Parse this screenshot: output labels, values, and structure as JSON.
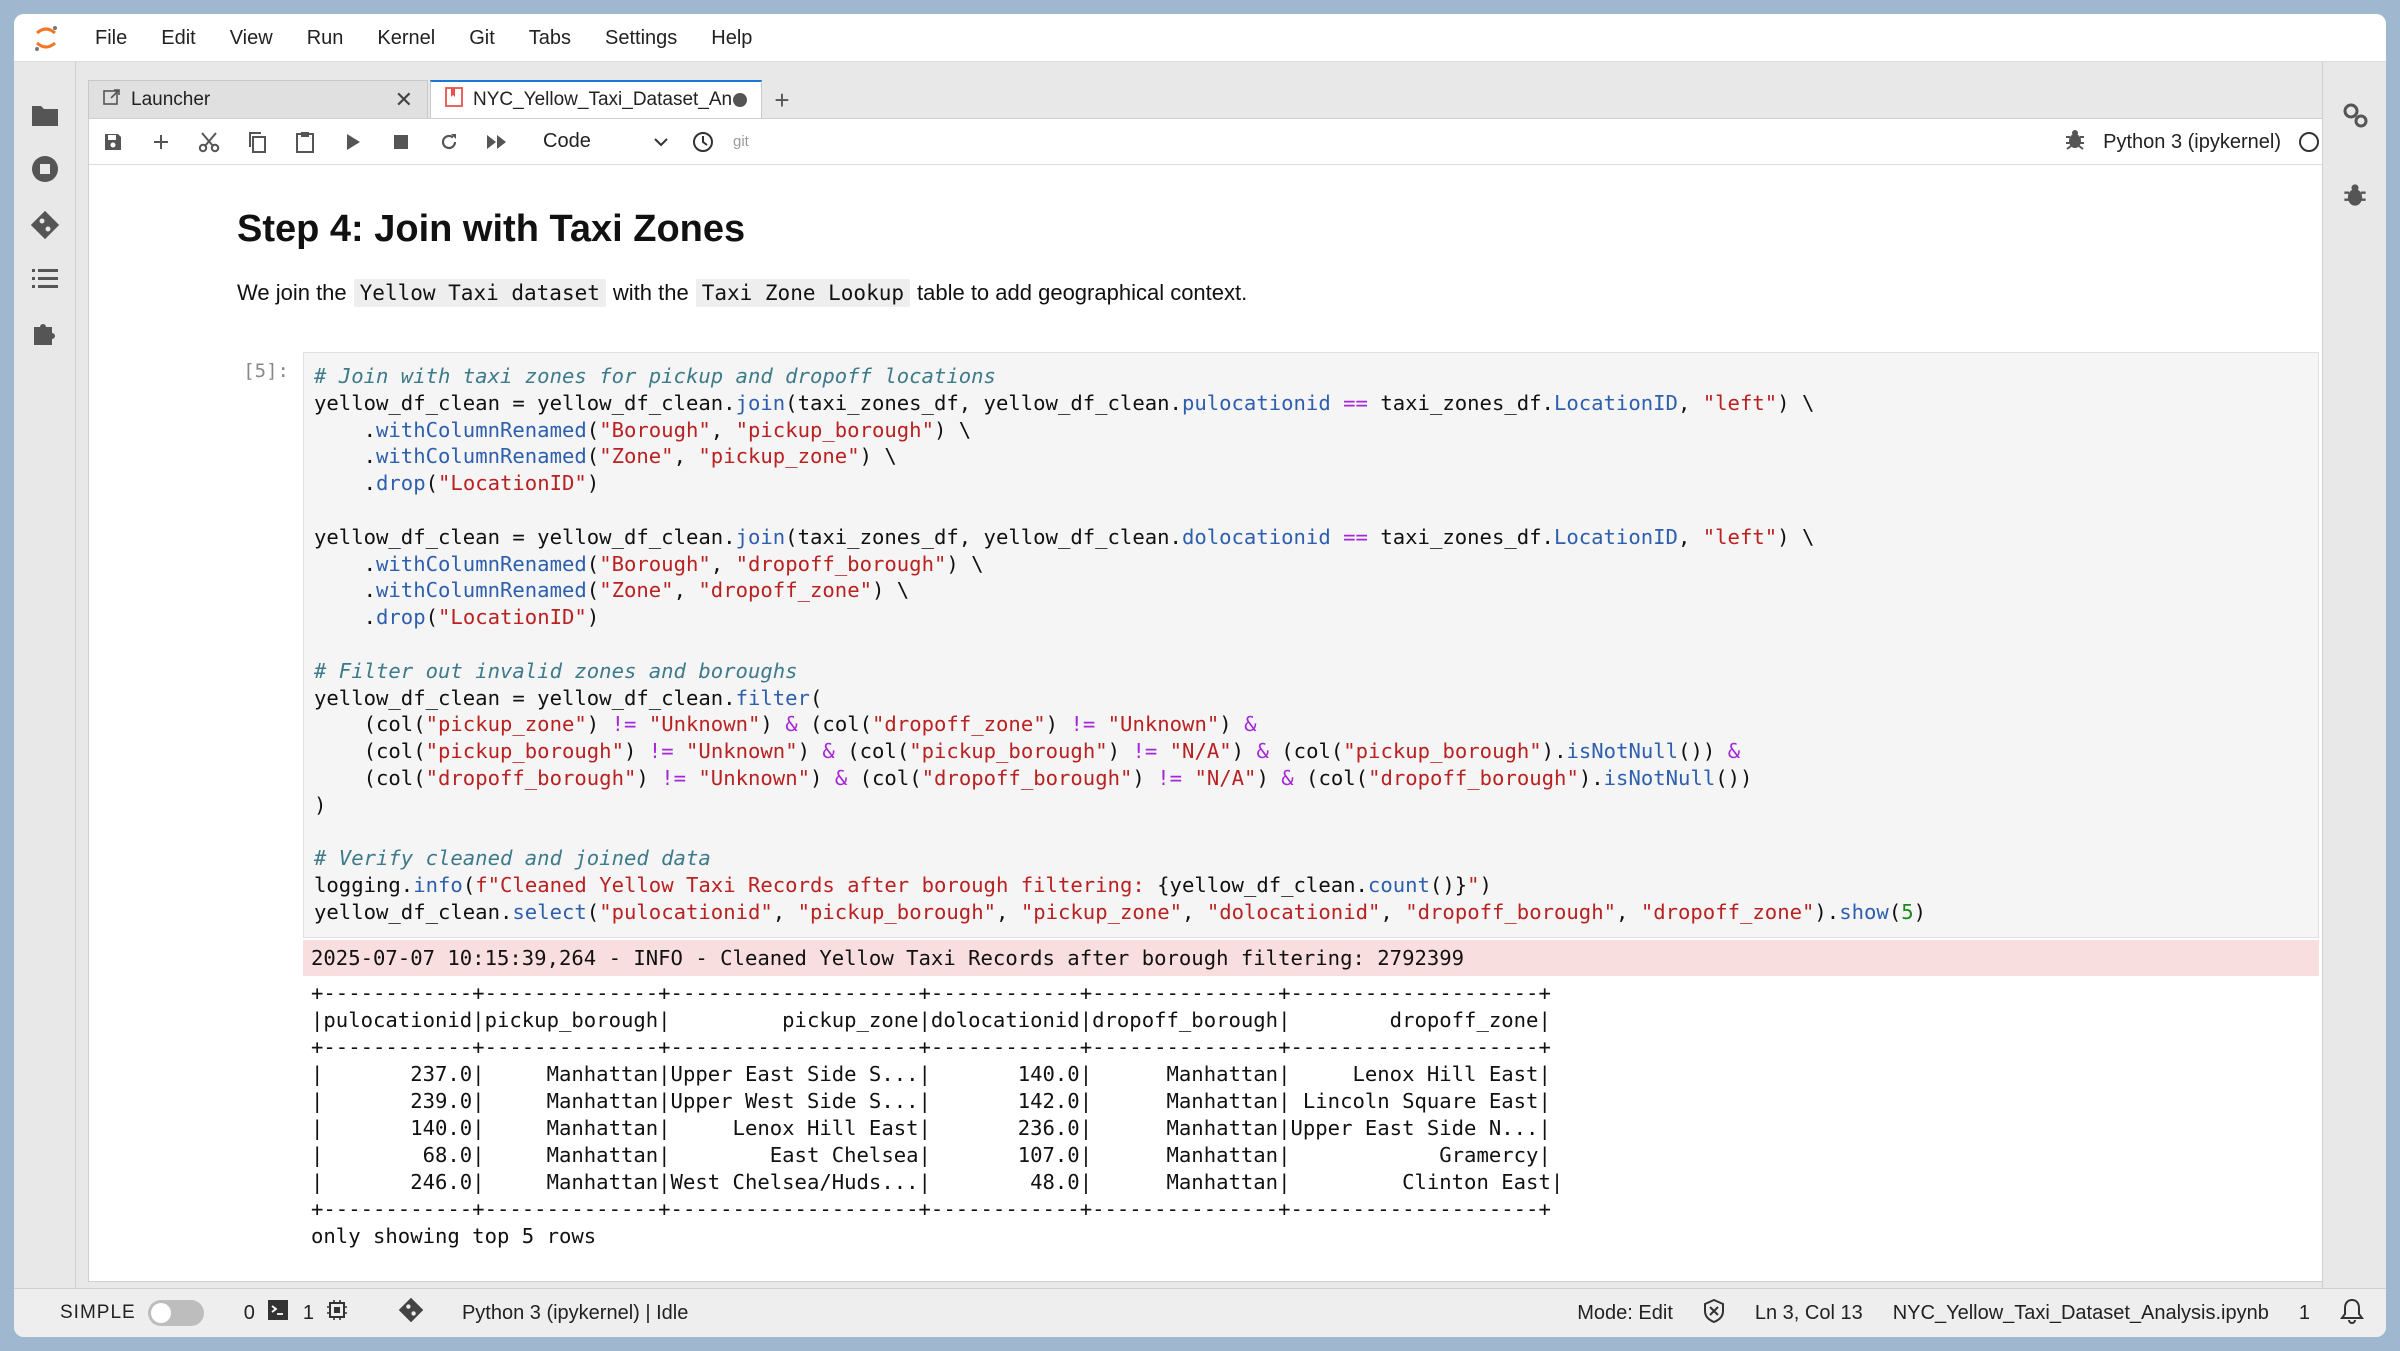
{
  "menu": [
    "File",
    "Edit",
    "View",
    "Run",
    "Kernel",
    "Git",
    "Tabs",
    "Settings",
    "Help"
  ],
  "tabs": [
    {
      "label": "Launcher",
      "icon": "launcher-icon"
    },
    {
      "label": "NYC_Yellow_Taxi_Dataset_Ana",
      "icon": "notebook-icon"
    }
  ],
  "toolbar": {
    "cell_type": "Code",
    "git_label": "git",
    "kernel_name": "Python 3 (ipykernel)"
  },
  "markdown": {
    "heading": "Step 4: Join with Taxi Zones",
    "p_before": "We join the",
    "code1": "Yellow Taxi dataset",
    "p_mid": "with the",
    "code2": "Taxi Zone Lookup",
    "p_after": "table to add geographical context."
  },
  "cell": {
    "prompt": "[5]:"
  },
  "output": {
    "stderr": "2025-07-07 10:15:39,264 - INFO - Cleaned Yellow Taxi Records after borough filtering: 2792399",
    "table_lines": [
      "+------------+--------------+--------------------+------------+---------------+--------------------+",
      "|pulocationid|pickup_borough|         pickup_zone|dolocationid|dropoff_borough|        dropoff_zone|",
      "+------------+--------------+--------------------+------------+---------------+--------------------+",
      "|       237.0|     Manhattan|Upper East Side S...|       140.0|      Manhattan|     Lenox Hill East|",
      "|       239.0|     Manhattan|Upper West Side S...|       142.0|      Manhattan| Lincoln Square East|",
      "|       140.0|     Manhattan|     Lenox Hill East|       236.0|      Manhattan|Upper East Side N...|",
      "|        68.0|     Manhattan|        East Chelsea|       107.0|      Manhattan|            Gramercy|",
      "|       246.0|     Manhattan|West Chelsea/Huds...|        48.0|      Manhattan|         Clinton East|",
      "+------------+--------------+--------------------+------------+---------------+--------------------+",
      "only showing top 5 rows"
    ]
  },
  "status": {
    "mode_label": "SIMPLE",
    "terminals_count": "0",
    "kernels_count": "1",
    "kernel_status": "Python 3 (ipykernel) | Idle",
    "mode": "Mode: Edit",
    "cursor": "Ln 3, Col 13",
    "filename": "NYC_Yellow_Taxi_Dataset_Analysis.ipynb",
    "notifications": "1"
  }
}
